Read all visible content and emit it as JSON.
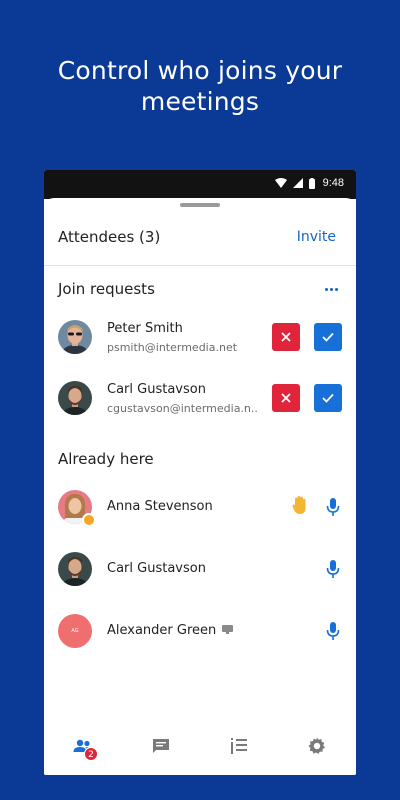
{
  "headline": [
    "Control who joins your",
    "meetings"
  ],
  "status": {
    "time": "9:48"
  },
  "header": {
    "title": "Attendees (3)",
    "invite_label": "Invite"
  },
  "join_requests": {
    "title": "Join requests",
    "people": [
      {
        "name": "Peter Smith",
        "email": "psmith@intermedia.net"
      },
      {
        "name": "Carl Gustavson",
        "email": "cgustavson@intermedia.n..."
      }
    ]
  },
  "already_here": {
    "title": "Already here",
    "people": [
      {
        "name": "Anna Stevenson"
      },
      {
        "name": "Carl Gustavson"
      },
      {
        "name": "Alexander Green",
        "initials": "AG"
      }
    ]
  },
  "tabbar": {
    "attendees_badge": "2"
  },
  "colors": {
    "brand_blue": "#0a3a96",
    "accent": "#1670d8",
    "deny": "#e0243a",
    "crown": "#f5a623",
    "hand": "#f2b632"
  },
  "icons": [
    "wifi-icon",
    "signal-icon",
    "battery-icon",
    "more-icon",
    "close-icon",
    "check-icon",
    "hand-raised-icon",
    "microphone-icon",
    "screen-share-icon",
    "people-icon",
    "chat-icon",
    "agenda-icon",
    "settings-icon"
  ]
}
